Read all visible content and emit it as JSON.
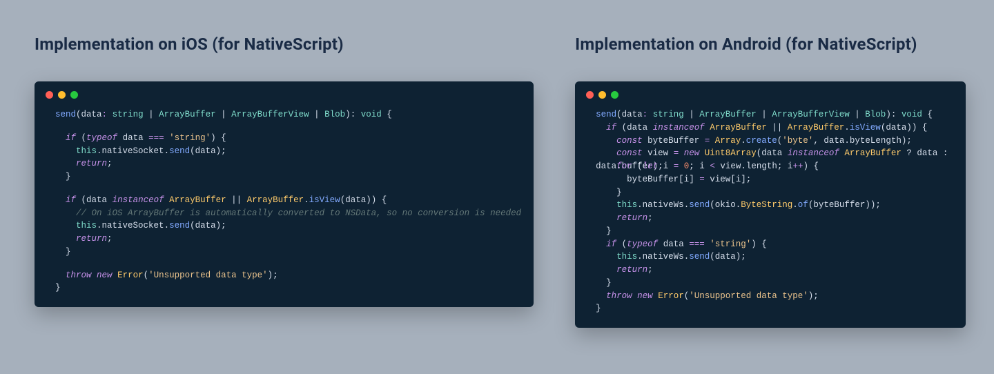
{
  "left": {
    "heading": "Implementation on iOS (for NativeScript)",
    "code_tokens": [
      [
        "fn",
        "send"
      ],
      [
        "pun",
        "("
      ],
      [
        "param",
        "data"
      ],
      [
        "op",
        ": "
      ],
      [
        "type",
        "string"
      ],
      [
        "pun",
        " | "
      ],
      [
        "type",
        "ArrayBuffer"
      ],
      [
        "pun",
        " | "
      ],
      [
        "type",
        "ArrayBufferView"
      ],
      [
        "pun",
        " | "
      ],
      [
        "type",
        "Blob"
      ],
      [
        "pun",
        "): "
      ],
      [
        "type",
        "void"
      ],
      [
        "pun",
        " {"
      ],
      [
        "nl",
        ""
      ],
      [
        "nl",
        ""
      ],
      [
        "pun",
        "  "
      ],
      [
        "kw",
        "if"
      ],
      [
        "pun",
        " ("
      ],
      [
        "kw",
        "typeof"
      ],
      [
        "pun",
        " data "
      ],
      [
        "op",
        "==="
      ],
      [
        "pun",
        " "
      ],
      [
        "str",
        "'string'"
      ],
      [
        "pun",
        ") {"
      ],
      [
        "nl",
        ""
      ],
      [
        "pun",
        "    "
      ],
      [
        "this",
        "this"
      ],
      [
        "pun",
        "."
      ],
      [
        "param",
        "nativeSocket"
      ],
      [
        "pun",
        "."
      ],
      [
        "call",
        "send"
      ],
      [
        "pun",
        "("
      ],
      [
        "param",
        "data"
      ],
      [
        "pun",
        ");"
      ],
      [
        "nl",
        ""
      ],
      [
        "pun",
        "    "
      ],
      [
        "kw",
        "return"
      ],
      [
        "pun",
        ";"
      ],
      [
        "nl",
        ""
      ],
      [
        "pun",
        "  }"
      ],
      [
        "nl",
        ""
      ],
      [
        "nl",
        ""
      ],
      [
        "pun",
        "  "
      ],
      [
        "kw",
        "if"
      ],
      [
        "pun",
        " ("
      ],
      [
        "param",
        "data"
      ],
      [
        "pun",
        " "
      ],
      [
        "kw",
        "instanceof"
      ],
      [
        "pun",
        " "
      ],
      [
        "class",
        "ArrayBuffer"
      ],
      [
        "pun",
        " || "
      ],
      [
        "class",
        "ArrayBuffer"
      ],
      [
        "pun",
        "."
      ],
      [
        "call",
        "isView"
      ],
      [
        "pun",
        "("
      ],
      [
        "param",
        "data"
      ],
      [
        "pun",
        ")) {"
      ],
      [
        "nl",
        ""
      ],
      [
        "pun",
        "    "
      ],
      [
        "comment",
        "// On iOS ArrayBuffer is automatically converted to NSData, so no conversion is needed"
      ],
      [
        "nl",
        ""
      ],
      [
        "pun",
        "    "
      ],
      [
        "this",
        "this"
      ],
      [
        "pun",
        "."
      ],
      [
        "param",
        "nativeSocket"
      ],
      [
        "pun",
        "."
      ],
      [
        "call",
        "send"
      ],
      [
        "pun",
        "("
      ],
      [
        "param",
        "data"
      ],
      [
        "pun",
        ");"
      ],
      [
        "nl",
        ""
      ],
      [
        "pun",
        "    "
      ],
      [
        "kw",
        "return"
      ],
      [
        "pun",
        ";"
      ],
      [
        "nl",
        ""
      ],
      [
        "pun",
        "  }"
      ],
      [
        "nl",
        ""
      ],
      [
        "nl",
        ""
      ],
      [
        "pun",
        "  "
      ],
      [
        "kw",
        "throw"
      ],
      [
        "pun",
        " "
      ],
      [
        "new",
        "new"
      ],
      [
        "pun",
        " "
      ],
      [
        "class",
        "Error"
      ],
      [
        "pun",
        "("
      ],
      [
        "str",
        "'Unsupported data type'"
      ],
      [
        "pun",
        ");"
      ],
      [
        "nl",
        ""
      ],
      [
        "pun",
        "}"
      ]
    ]
  },
  "right": {
    "heading": "Implementation on Android (for NativeScript)",
    "code_tokens": [
      [
        "fn",
        "send"
      ],
      [
        "pun",
        "("
      ],
      [
        "param",
        "data"
      ],
      [
        "op",
        ": "
      ],
      [
        "type",
        "string"
      ],
      [
        "pun",
        " | "
      ],
      [
        "type",
        "ArrayBuffer"
      ],
      [
        "pun",
        " | "
      ],
      [
        "type",
        "ArrayBufferView"
      ],
      [
        "pun",
        " | "
      ],
      [
        "type",
        "Blob"
      ],
      [
        "pun",
        "): "
      ],
      [
        "type",
        "void"
      ],
      [
        "pun",
        " {"
      ],
      [
        "nl",
        ""
      ],
      [
        "pun",
        "  "
      ],
      [
        "kw",
        "if"
      ],
      [
        "pun",
        " ("
      ],
      [
        "param",
        "data"
      ],
      [
        "pun",
        " "
      ],
      [
        "kw",
        "instanceof"
      ],
      [
        "pun",
        " "
      ],
      [
        "class",
        "ArrayBuffer"
      ],
      [
        "pun",
        " || "
      ],
      [
        "class",
        "ArrayBuffer"
      ],
      [
        "pun",
        "."
      ],
      [
        "call",
        "isView"
      ],
      [
        "pun",
        "("
      ],
      [
        "param",
        "data"
      ],
      [
        "pun",
        ")) {"
      ],
      [
        "nl",
        ""
      ],
      [
        "pun",
        "    "
      ],
      [
        "kw",
        "const"
      ],
      [
        "pun",
        " "
      ],
      [
        "param",
        "byteBuffer"
      ],
      [
        "pun",
        " "
      ],
      [
        "op",
        "="
      ],
      [
        "pun",
        " "
      ],
      [
        "class",
        "Array"
      ],
      [
        "pun",
        "."
      ],
      [
        "call",
        "create"
      ],
      [
        "pun",
        "("
      ],
      [
        "str",
        "'byte'"
      ],
      [
        "pun",
        ", "
      ],
      [
        "param",
        "data"
      ],
      [
        "pun",
        "."
      ],
      [
        "param",
        "byteLength"
      ],
      [
        "pun",
        ");"
      ],
      [
        "nl",
        ""
      ],
      [
        "pun",
        "    "
      ],
      [
        "kw",
        "const"
      ],
      [
        "pun",
        " "
      ],
      [
        "param",
        "view"
      ],
      [
        "pun",
        " "
      ],
      [
        "op",
        "="
      ],
      [
        "pun",
        " "
      ],
      [
        "new",
        "new"
      ],
      [
        "pun",
        " "
      ],
      [
        "class",
        "Uint8Array"
      ],
      [
        "pun",
        "("
      ],
      [
        "param",
        "data"
      ],
      [
        "pun",
        " "
      ],
      [
        "kw",
        "instanceof"
      ],
      [
        "pun",
        " "
      ],
      [
        "class",
        "ArrayBuffer"
      ],
      [
        "pun",
        " ? "
      ],
      [
        "param",
        "data"
      ],
      [
        "pun",
        " : "
      ],
      [
        "nl",
        ""
      ],
      [
        "param",
        "data"
      ],
      [
        "pun",
        "."
      ],
      [
        "param",
        "buffer"
      ],
      [
        "pun",
        ");"
      ],
      [
        "nlover",
        ""
      ],
      [
        "pun",
        "    "
      ],
      [
        "kw",
        "for"
      ],
      [
        "pun",
        " ("
      ],
      [
        "kw",
        "let"
      ],
      [
        "pun",
        " "
      ],
      [
        "param",
        "i"
      ],
      [
        "pun",
        " "
      ],
      [
        "op",
        "="
      ],
      [
        "pun",
        " "
      ],
      [
        "num",
        "0"
      ],
      [
        "pun",
        "; "
      ],
      [
        "param",
        "i"
      ],
      [
        "pun",
        " "
      ],
      [
        "op",
        "<"
      ],
      [
        "pun",
        " "
      ],
      [
        "param",
        "view"
      ],
      [
        "pun",
        "."
      ],
      [
        "param",
        "length"
      ],
      [
        "pun",
        "; "
      ],
      [
        "param",
        "i"
      ],
      [
        "op",
        "++"
      ],
      [
        "pun",
        ") {"
      ],
      [
        "nl",
        ""
      ],
      [
        "pun",
        "      "
      ],
      [
        "param",
        "byteBuffer"
      ],
      [
        "pun",
        "["
      ],
      [
        "param",
        "i"
      ],
      [
        "pun",
        "] "
      ],
      [
        "op",
        "="
      ],
      [
        "pun",
        " "
      ],
      [
        "param",
        "view"
      ],
      [
        "pun",
        "["
      ],
      [
        "param",
        "i"
      ],
      [
        "pun",
        "];"
      ],
      [
        "nl",
        ""
      ],
      [
        "pun",
        "    }"
      ],
      [
        "nl",
        ""
      ],
      [
        "pun",
        "    "
      ],
      [
        "this",
        "this"
      ],
      [
        "pun",
        "."
      ],
      [
        "param",
        "nativeWs"
      ],
      [
        "pun",
        "."
      ],
      [
        "call",
        "send"
      ],
      [
        "pun",
        "("
      ],
      [
        "param",
        "okio"
      ],
      [
        "pun",
        "."
      ],
      [
        "class",
        "ByteString"
      ],
      [
        "pun",
        "."
      ],
      [
        "call",
        "of"
      ],
      [
        "pun",
        "("
      ],
      [
        "param",
        "byteBuffer"
      ],
      [
        "pun",
        "));"
      ],
      [
        "nl",
        ""
      ],
      [
        "pun",
        "    "
      ],
      [
        "kw",
        "return"
      ],
      [
        "pun",
        ";"
      ],
      [
        "nl",
        ""
      ],
      [
        "pun",
        "  }"
      ],
      [
        "nl",
        ""
      ],
      [
        "pun",
        "  "
      ],
      [
        "kw",
        "if"
      ],
      [
        "pun",
        " ("
      ],
      [
        "kw",
        "typeof"
      ],
      [
        "pun",
        " data "
      ],
      [
        "op",
        "==="
      ],
      [
        "pun",
        " "
      ],
      [
        "str",
        "'string'"
      ],
      [
        "pun",
        ") {"
      ],
      [
        "nl",
        ""
      ],
      [
        "pun",
        "    "
      ],
      [
        "this",
        "this"
      ],
      [
        "pun",
        "."
      ],
      [
        "param",
        "nativeWs"
      ],
      [
        "pun",
        "."
      ],
      [
        "call",
        "send"
      ],
      [
        "pun",
        "("
      ],
      [
        "param",
        "data"
      ],
      [
        "pun",
        ");"
      ],
      [
        "nl",
        ""
      ],
      [
        "pun",
        "    "
      ],
      [
        "kw",
        "return"
      ],
      [
        "pun",
        ";"
      ],
      [
        "nl",
        ""
      ],
      [
        "pun",
        "  }"
      ],
      [
        "nl",
        ""
      ],
      [
        "pun",
        "  "
      ],
      [
        "kw",
        "throw"
      ],
      [
        "pun",
        " "
      ],
      [
        "new",
        "new"
      ],
      [
        "pun",
        " "
      ],
      [
        "class",
        "Error"
      ],
      [
        "pun",
        "("
      ],
      [
        "str",
        "'Unsupported data type'"
      ],
      [
        "pun",
        ");"
      ],
      [
        "nl",
        ""
      ],
      [
        "pun",
        "}"
      ]
    ]
  }
}
